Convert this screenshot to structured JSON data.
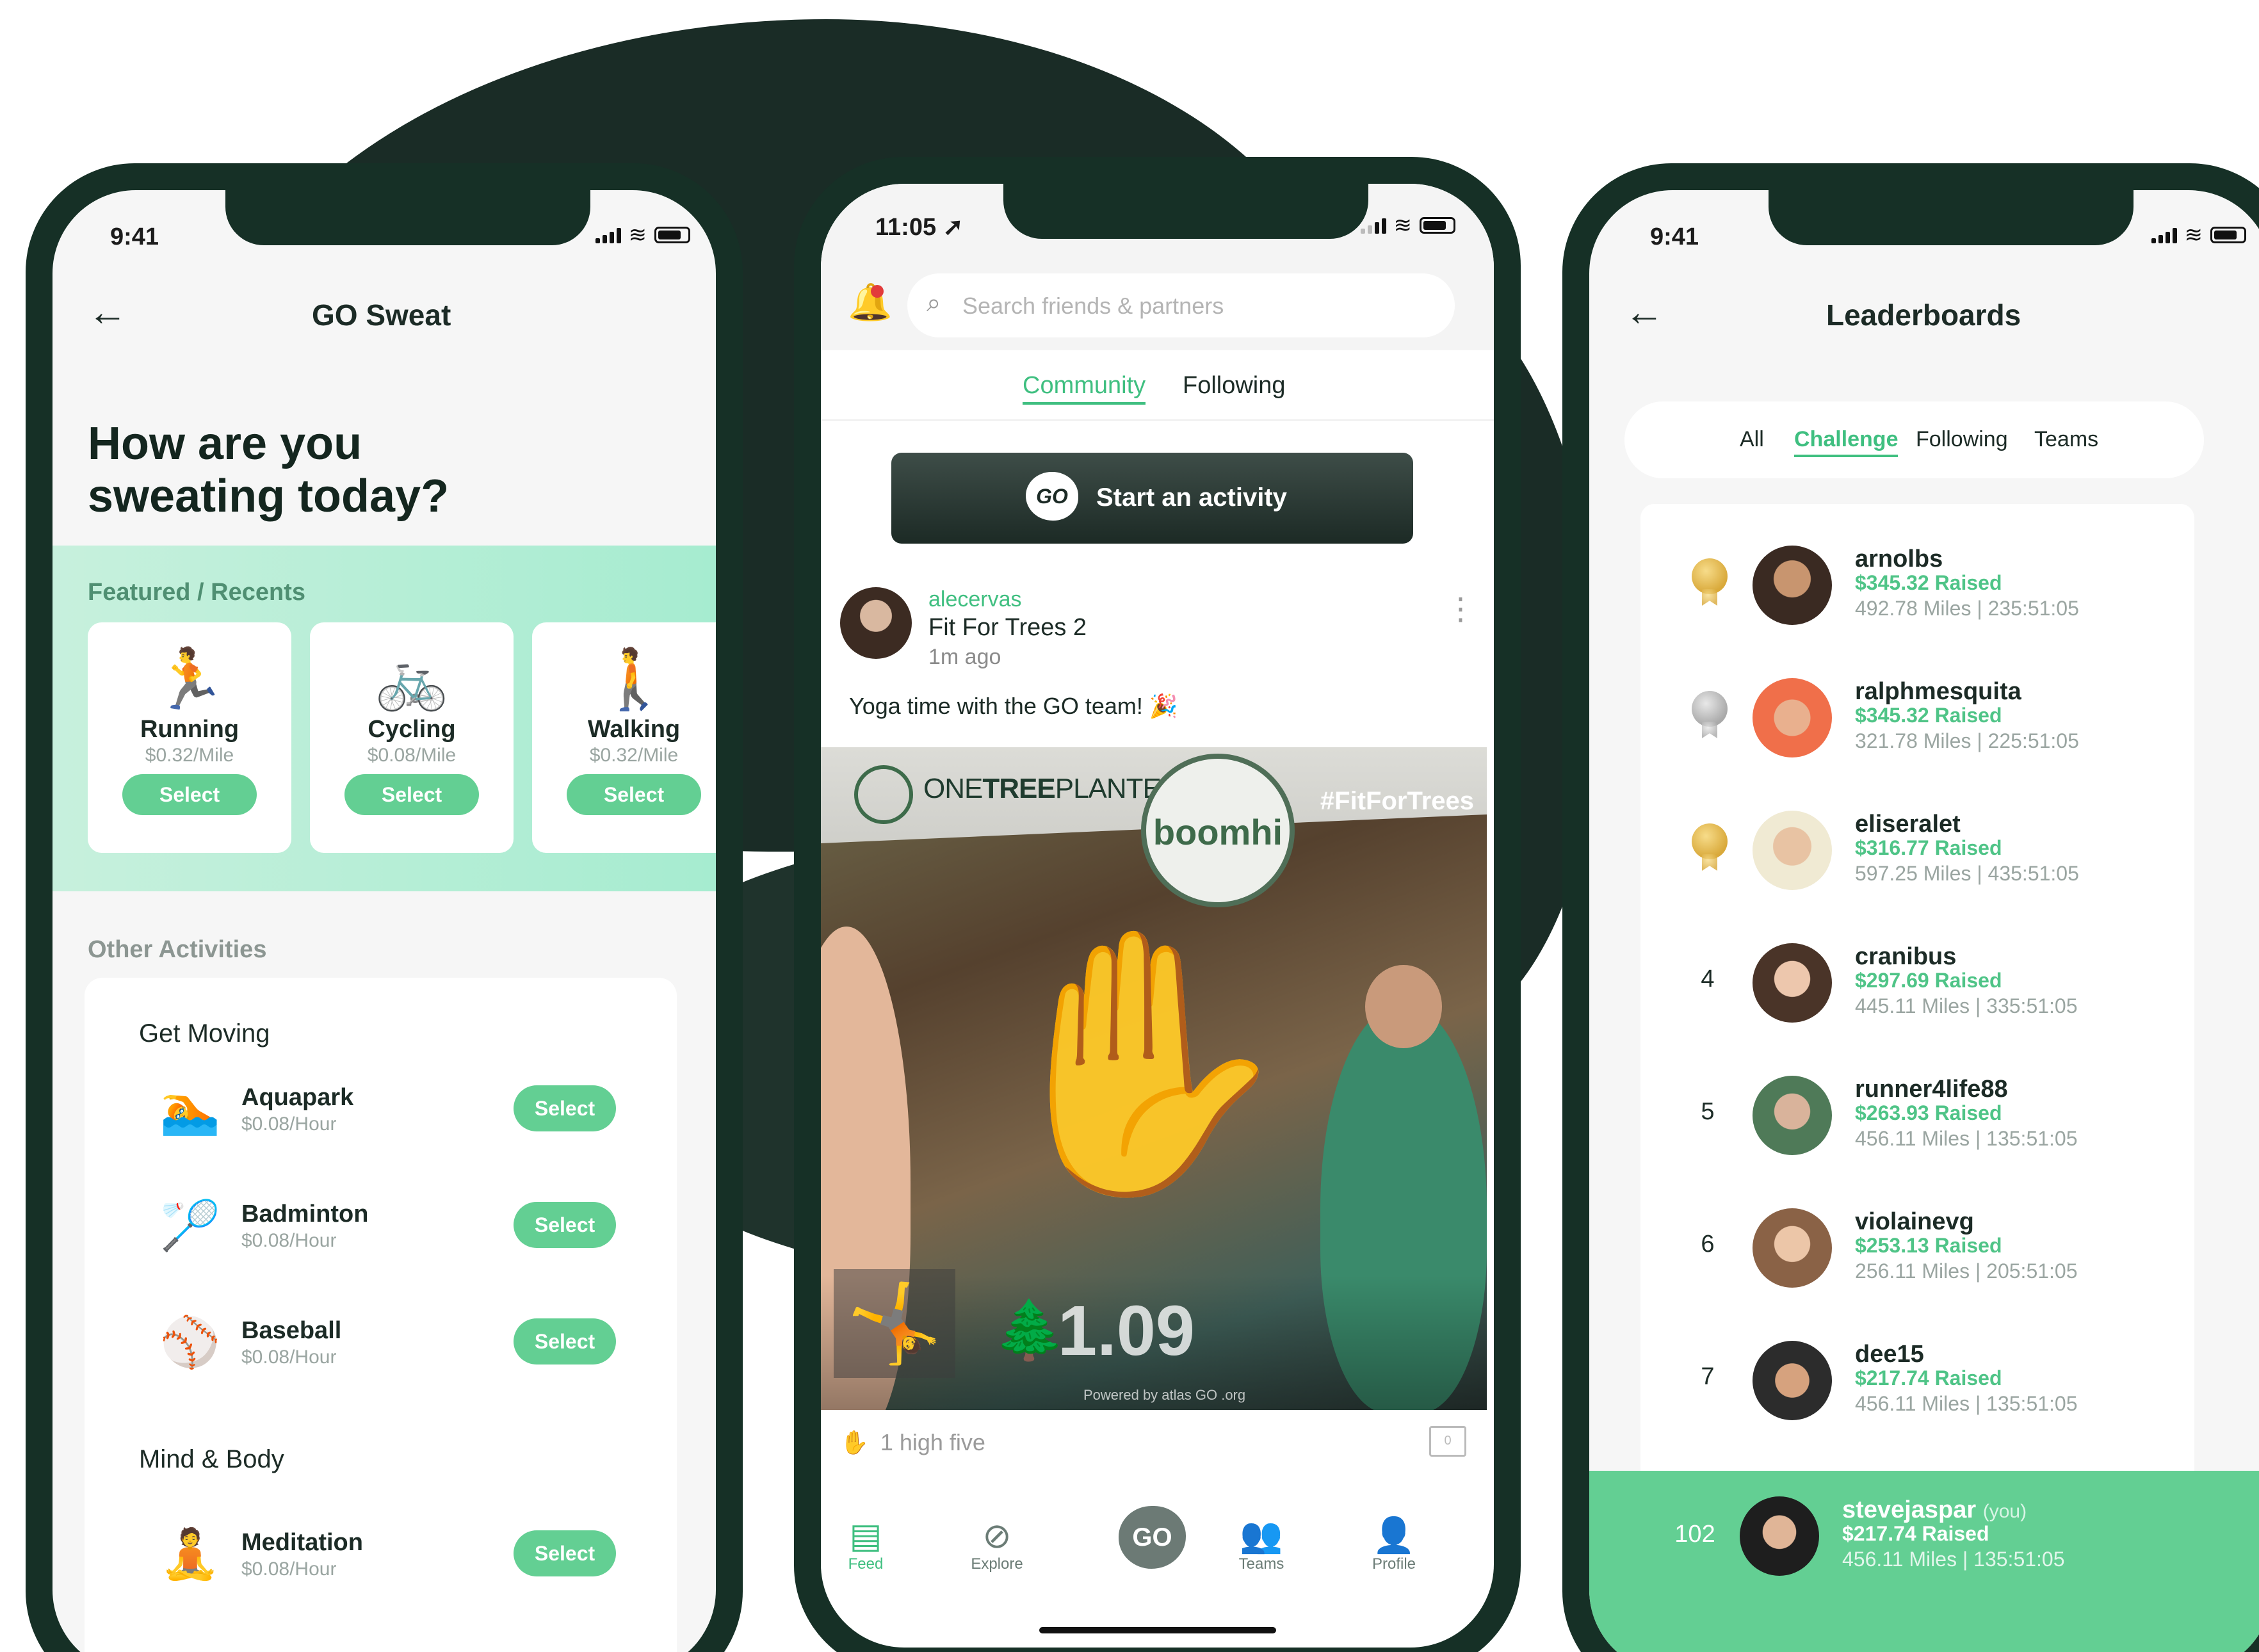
{
  "status": {
    "time_left": "9:41",
    "time_center": "11:05",
    "time_right": "9:41"
  },
  "sweat": {
    "title": "GO Sweat",
    "hero": "How are you sweating today?",
    "featured_title": "Featured / Recents",
    "featured": [
      {
        "name": "Running",
        "price": "$0.32/Mile",
        "icon": "running-icon",
        "glyph": "🏃",
        "select": "Select"
      },
      {
        "name": "Cycling",
        "price": "$0.08/Mile",
        "icon": "cycling-icon",
        "glyph": "🚲",
        "select": "Select"
      },
      {
        "name": "Walking",
        "price": "$0.32/Mile",
        "icon": "walking-icon",
        "glyph": "🚶",
        "select": "Select"
      }
    ],
    "other_title": "Other Activities",
    "group1": "Get Moving",
    "group2": "Mind & Body",
    "activities": [
      {
        "name": "Aquapark",
        "price": "$0.08/Hour",
        "icon": "swimming-icon",
        "glyph": "🏊",
        "select": "Select"
      },
      {
        "name": "Badminton",
        "price": "$0.08/Hour",
        "icon": "badminton-icon",
        "glyph": "🏸",
        "select": "Select"
      },
      {
        "name": "Baseball",
        "price": "$0.08/Hour",
        "icon": "baseball-icon",
        "glyph": "⚾",
        "select": "Select"
      },
      {
        "name": "Meditation",
        "price": "$0.08/Hour",
        "icon": "meditation-icon",
        "glyph": "🧘",
        "select": "Select"
      }
    ]
  },
  "feed": {
    "search_placeholder": "Search friends & partners",
    "tabs": [
      "Community",
      "Following"
    ],
    "start_label": "Start an activity",
    "go_badge": "GO",
    "post": {
      "user": "alecervas",
      "title": "Fit For Trees 2",
      "time": "1m ago",
      "text": "Yoga time with the GO team! 🎉",
      "brand": "ONETREEPLANTED",
      "brand_bold": "TREE",
      "partner": "boomhi",
      "hashtag": "#FitForTrees",
      "distance": "1.09",
      "powered": "Powered by atlas GO .org",
      "high_fives": "1 high five",
      "comments": "0"
    },
    "tabbar": [
      {
        "label": "Feed",
        "icon": "feed-icon",
        "glyph": "▤"
      },
      {
        "label": "Explore",
        "icon": "compass-icon",
        "glyph": "⊘"
      },
      {
        "label": "Teams",
        "icon": "teams-icon",
        "glyph": "👥"
      },
      {
        "label": "Profile",
        "icon": "profile-icon",
        "glyph": "👤"
      }
    ],
    "go_fab": "GO"
  },
  "leaderboard": {
    "title": "Leaderboards",
    "tabs": [
      "All",
      "Challenge",
      "Following",
      "Teams"
    ],
    "rows": [
      {
        "rank": "",
        "medal": "gold",
        "user": "arnolbs",
        "raised": "$345.32 Raised",
        "stats": "492.78 Miles | 235:51:05"
      },
      {
        "rank": "",
        "medal": "silver",
        "user": "ralphmesquita",
        "raised": "$345.32 Raised",
        "stats": "321.78 Miles | 225:51:05"
      },
      {
        "rank": "",
        "medal": "gold",
        "user": "eliseralet",
        "raised": "$316.77 Raised",
        "stats": "597.25 Miles | 435:51:05"
      },
      {
        "rank": "4",
        "medal": "",
        "user": "cranibus",
        "raised": "$297.69 Raised",
        "stats": "445.11 Miles | 335:51:05"
      },
      {
        "rank": "5",
        "medal": "",
        "user": "runner4life88",
        "raised": "$263.93 Raised",
        "stats": "456.11 Miles | 135:51:05"
      },
      {
        "rank": "6",
        "medal": "",
        "user": "violainevg",
        "raised": "$253.13 Raised",
        "stats": "256.11 Miles | 205:51:05"
      },
      {
        "rank": "7",
        "medal": "",
        "user": "dee15",
        "raised": "$217.74 Raised",
        "stats": "456.11 Miles | 135:51:05"
      }
    ],
    "you": {
      "rank": "102",
      "user": "stevejaspar",
      "you_tag": "(you)",
      "raised": "$217.74 Raised",
      "stats": "456.11 Miles | 135:51:05"
    }
  }
}
